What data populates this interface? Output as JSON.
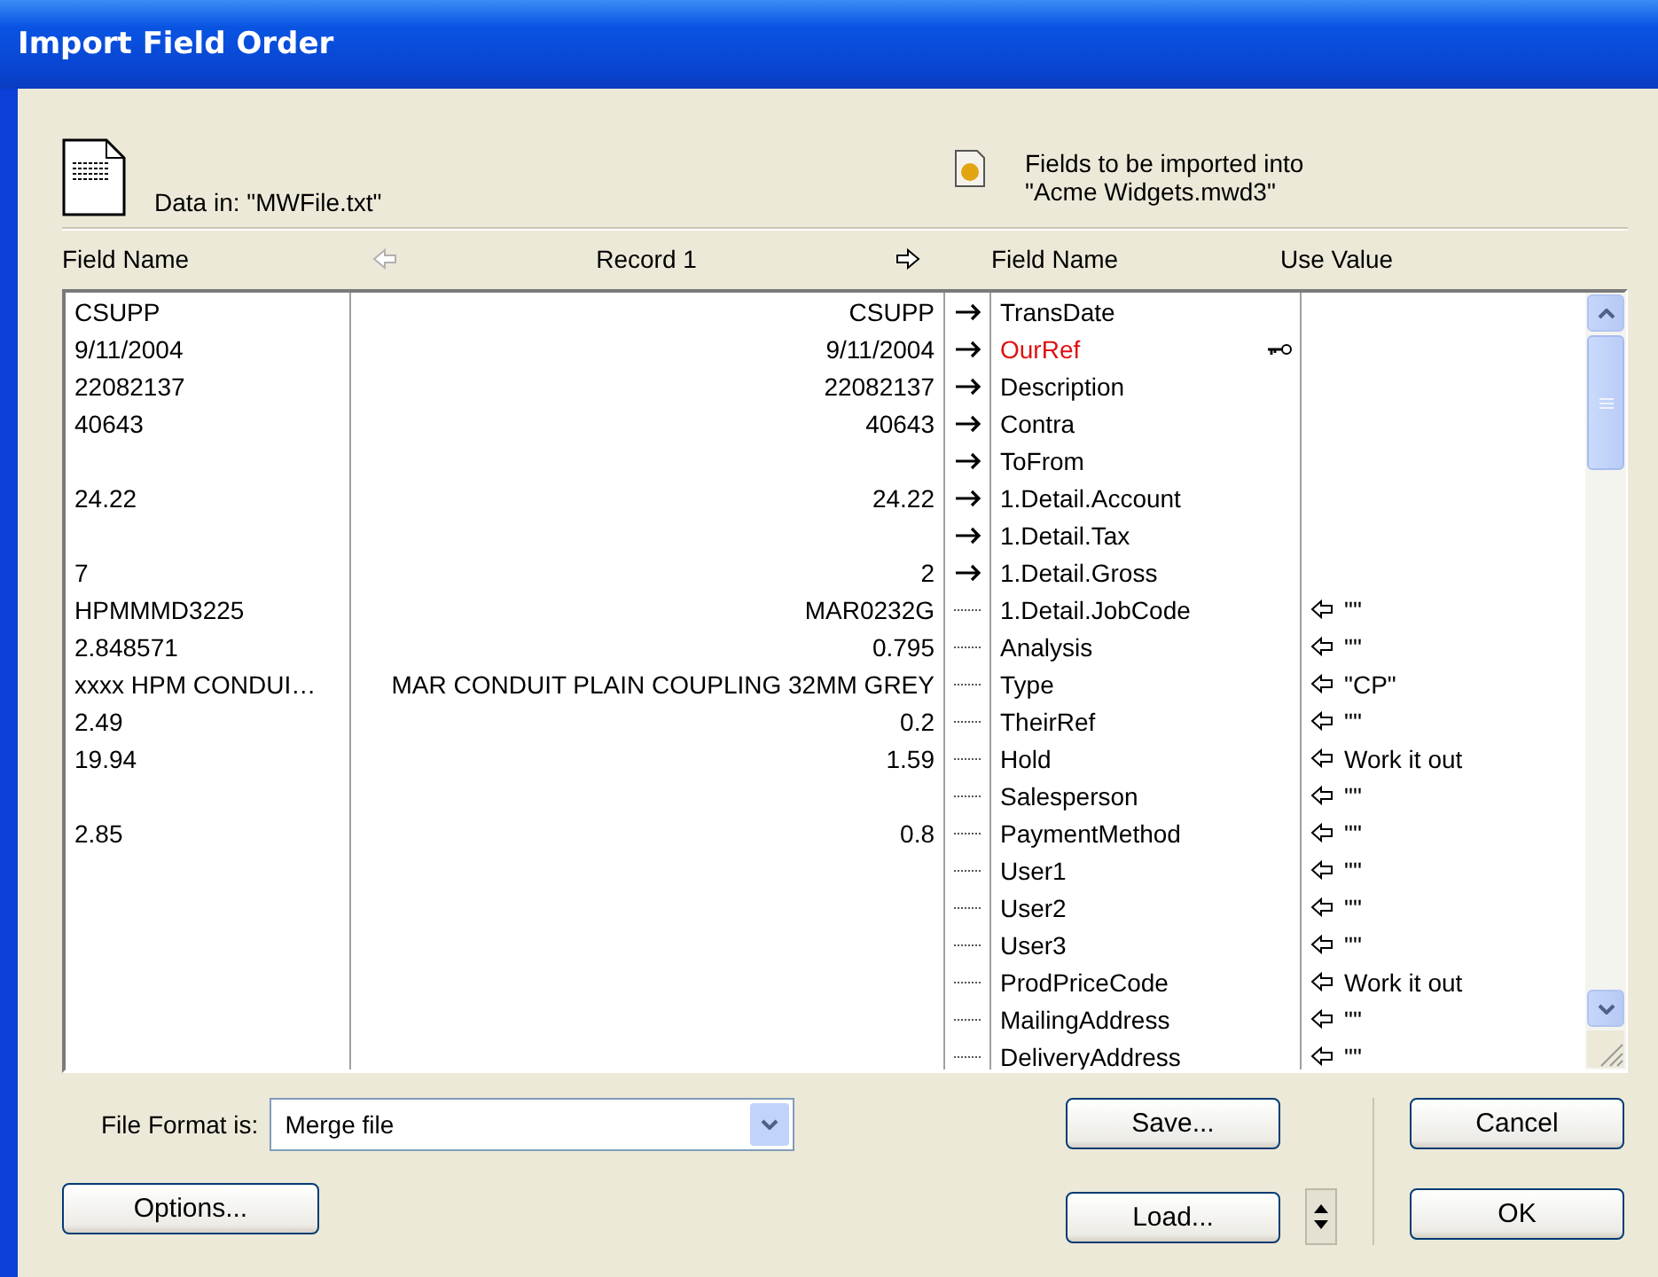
{
  "window": {
    "title": "Import Field Order"
  },
  "source": {
    "label": "Data in:  \"MWFile.txt\""
  },
  "target": {
    "label_line1": "Fields to be imported into",
    "label_line2": "\"Acme Widgets.mwd3\""
  },
  "columns": {
    "source_field": "Field Name",
    "record": "Record 1",
    "field": "Field Name",
    "use_value": "Use Value"
  },
  "record_nav": {
    "previous_enabled": false,
    "next_enabled": true
  },
  "rows": [
    {
      "source": "CSUPP",
      "record": "CSUPP",
      "kind": "mapped",
      "field": "TransDate",
      "key": false,
      "required": false
    },
    {
      "source": "9/11/2004",
      "record": "9/11/2004",
      "kind": "mapped",
      "field": "OurRef",
      "key": true,
      "required": true
    },
    {
      "source": "22082137",
      "record": "22082137",
      "kind": "mapped",
      "field": "Description",
      "key": false,
      "required": false
    },
    {
      "source": "40643",
      "record": "40643",
      "kind": "mapped",
      "field": "Contra",
      "key": false,
      "required": false
    },
    {
      "kind": "mapped",
      "field": "ToFrom",
      "key": false,
      "required": false
    },
    {
      "source": "24.22",
      "record": "24.22",
      "kind": "mapped",
      "field": "1.Detail.Account",
      "key": false,
      "required": false
    },
    {
      "kind": "mapped",
      "field": "1.Detail.Tax",
      "key": false,
      "required": false
    },
    {
      "source": "7",
      "record": "2",
      "kind": "mapped",
      "field": "1.Detail.Gross",
      "key": false,
      "required": false
    },
    {
      "source": "HPMMMD3225",
      "record": "MAR0232G",
      "kind": "unmapped",
      "field": "1.Detail.JobCode",
      "key": false,
      "required": false,
      "use_value": "\"\""
    },
    {
      "source": "2.848571",
      "record": "0.795",
      "kind": "unmapped",
      "field": "Analysis",
      "key": false,
      "required": false,
      "use_value": "\"\""
    },
    {
      "source": "xxxx HPM CONDUI…",
      "record": "MAR CONDUIT PLAIN COUPLING 32MM GREY",
      "kind": "unmapped",
      "field": "Type",
      "key": false,
      "required": false,
      "use_value": "\"CP\""
    },
    {
      "source": "2.49",
      "record": "0.2",
      "kind": "unmapped",
      "field": "TheirRef",
      "key": false,
      "required": false,
      "use_value": "\"\""
    },
    {
      "source": "19.94",
      "record": "1.59",
      "kind": "unmapped",
      "field": "Hold",
      "key": false,
      "required": false,
      "use_value": "Work it out"
    },
    {
      "kind": "unmapped",
      "field": "Salesperson",
      "key": false,
      "required": false,
      "use_value": "\"\""
    },
    {
      "source": "2.85",
      "record": "0.8",
      "kind": "unmapped",
      "field": "PaymentMethod",
      "key": false,
      "required": false,
      "use_value": "\"\""
    },
    {
      "kind": "unmapped",
      "field": "User1",
      "key": false,
      "required": false,
      "use_value": "\"\""
    },
    {
      "kind": "unmapped",
      "field": "User2",
      "key": false,
      "required": false,
      "use_value": "\"\""
    },
    {
      "kind": "unmapped",
      "field": "User3",
      "key": false,
      "required": false,
      "use_value": "\"\""
    },
    {
      "kind": "unmapped",
      "field": "ProdPriceCode",
      "key": false,
      "required": false,
      "use_value": "Work it out"
    },
    {
      "kind": "unmapped",
      "field": "MailingAddress",
      "key": false,
      "required": false,
      "use_value": "\"\""
    },
    {
      "kind": "unmapped",
      "field": "DeliveryAddress",
      "key": false,
      "required": false,
      "use_value": "\"\""
    }
  ],
  "file_format": {
    "label": "File Format is:",
    "value": "Merge file"
  },
  "buttons": {
    "options": "Options...",
    "save": "Save...",
    "load": "Load...",
    "cancel": "Cancel",
    "ok": "OK"
  }
}
